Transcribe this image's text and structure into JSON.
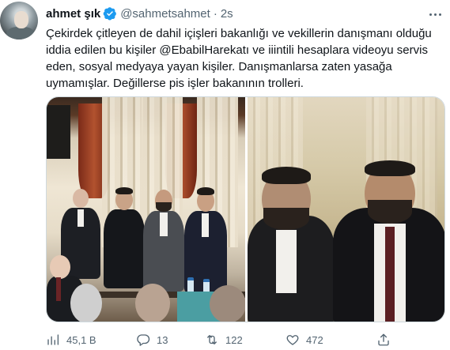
{
  "tweet": {
    "display_name": "ahmet şık",
    "handle": "@sahmetsahmet",
    "separator": "·",
    "time": "2s",
    "text_lines": [
      "Çekirdek çitleyen de dahil içişleri bakanlığı ve vekillerin danışmanı olduğu",
      "iddia edilen bu kişiler @EbabilHarekatı ve iiintili hesaplara videoyu servis",
      "eden, sosyal medyaya yayan kişiler. Danışmanlarsa zaten yasağa",
      "uymamışlar. Değillerse pis işler bakanının trolleri."
    ],
    "verified_color": "#1d9bf0"
  },
  "media": {
    "photos": [
      "photo-left",
      "photo-right"
    ]
  },
  "actions": {
    "views": "45,1 B",
    "replies": "13",
    "retweets": "122",
    "likes": "472",
    "icons": {
      "views": "analytics-icon",
      "reply": "reply-icon",
      "retweet": "retweet-icon",
      "like": "heart-icon",
      "share": "share-icon"
    }
  }
}
